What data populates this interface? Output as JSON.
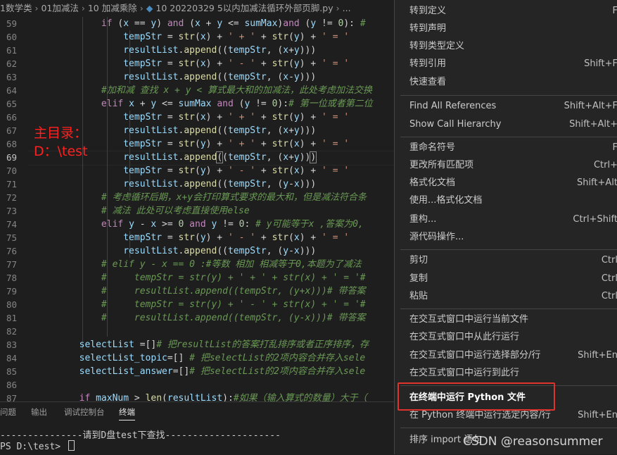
{
  "breadcrumb": {
    "items": [
      "1数学类",
      "01加减法",
      "10 加减乘除",
      "10 20220329 5以内加减法循环外部页脚.py",
      "..."
    ]
  },
  "editor": {
    "line_numbers": [
      "59",
      "60",
      "61",
      "62",
      "63",
      "64",
      "65",
      "66",
      "67",
      "68",
      "69",
      "70",
      "71",
      "72",
      "73",
      "74",
      "75",
      "76",
      "77",
      "78",
      "79",
      "80",
      "81",
      "82",
      "83",
      "84",
      "85",
      "86",
      "87"
    ],
    "current_line": "69",
    "annotation": "主目录：\nD：\\test"
  },
  "panel": {
    "tabs": [
      "问题",
      "输出",
      "调试控制台",
      "终端"
    ],
    "active_tab": "终端",
    "terminal_lines": [
      "---------------请到D盘test下查找---------------------",
      "PS D:\\test> "
    ]
  },
  "context_menu": {
    "items": [
      {
        "label": "转到定义",
        "shortcut": "F"
      },
      {
        "label": "转到声明",
        "shortcut": ""
      },
      {
        "label": "转到类型定义",
        "shortcut": ""
      },
      {
        "label": "转到引用",
        "shortcut": "Shift+F"
      },
      {
        "label": "快速查看",
        "shortcut": ""
      },
      {
        "label": "Find All References",
        "shortcut": "Shift+Alt+F"
      },
      {
        "label": "Show Call Hierarchy",
        "shortcut": "Shift+Alt+"
      },
      {
        "label": "重命名符号",
        "shortcut": "F"
      },
      {
        "label": "更改所有匹配项",
        "shortcut": "Ctrl+"
      },
      {
        "label": "格式化文档",
        "shortcut": "Shift+Alt"
      },
      {
        "label": "使用...格式化文档",
        "shortcut": ""
      },
      {
        "label": "重构...",
        "shortcut": "Ctrl+Shift"
      },
      {
        "label": "源代码操作...",
        "shortcut": ""
      },
      {
        "label": "剪切",
        "shortcut": "Ctrl"
      },
      {
        "label": "复制",
        "shortcut": "Ctrl"
      },
      {
        "label": "粘贴",
        "shortcut": "Ctrl"
      },
      {
        "label": "在交互式窗口中运行当前文件",
        "shortcut": ""
      },
      {
        "label": "在交互式窗口中从此行运行",
        "shortcut": ""
      },
      {
        "label": "在交互式窗口中运行选择部分/行",
        "shortcut": "Shift+En"
      },
      {
        "label": "在交互式窗口中运行到此行",
        "shortcut": ""
      },
      {
        "label": "在终端中运行 Python 文件",
        "shortcut": ""
      },
      {
        "label": "在 Python 终端中运行选定内容/行",
        "shortcut": "Shift+En"
      },
      {
        "label": "排序 import 语句",
        "shortcut": ""
      }
    ],
    "highlighted_item": "在终端中运行 Python 文件"
  },
  "watermark": "CSDN @reasonsummer",
  "colors": {
    "annotation": "#ff2020",
    "highlight_box": "#e0332b",
    "menu_bg": "#252526",
    "editor_bg": "#1e1e1e"
  }
}
